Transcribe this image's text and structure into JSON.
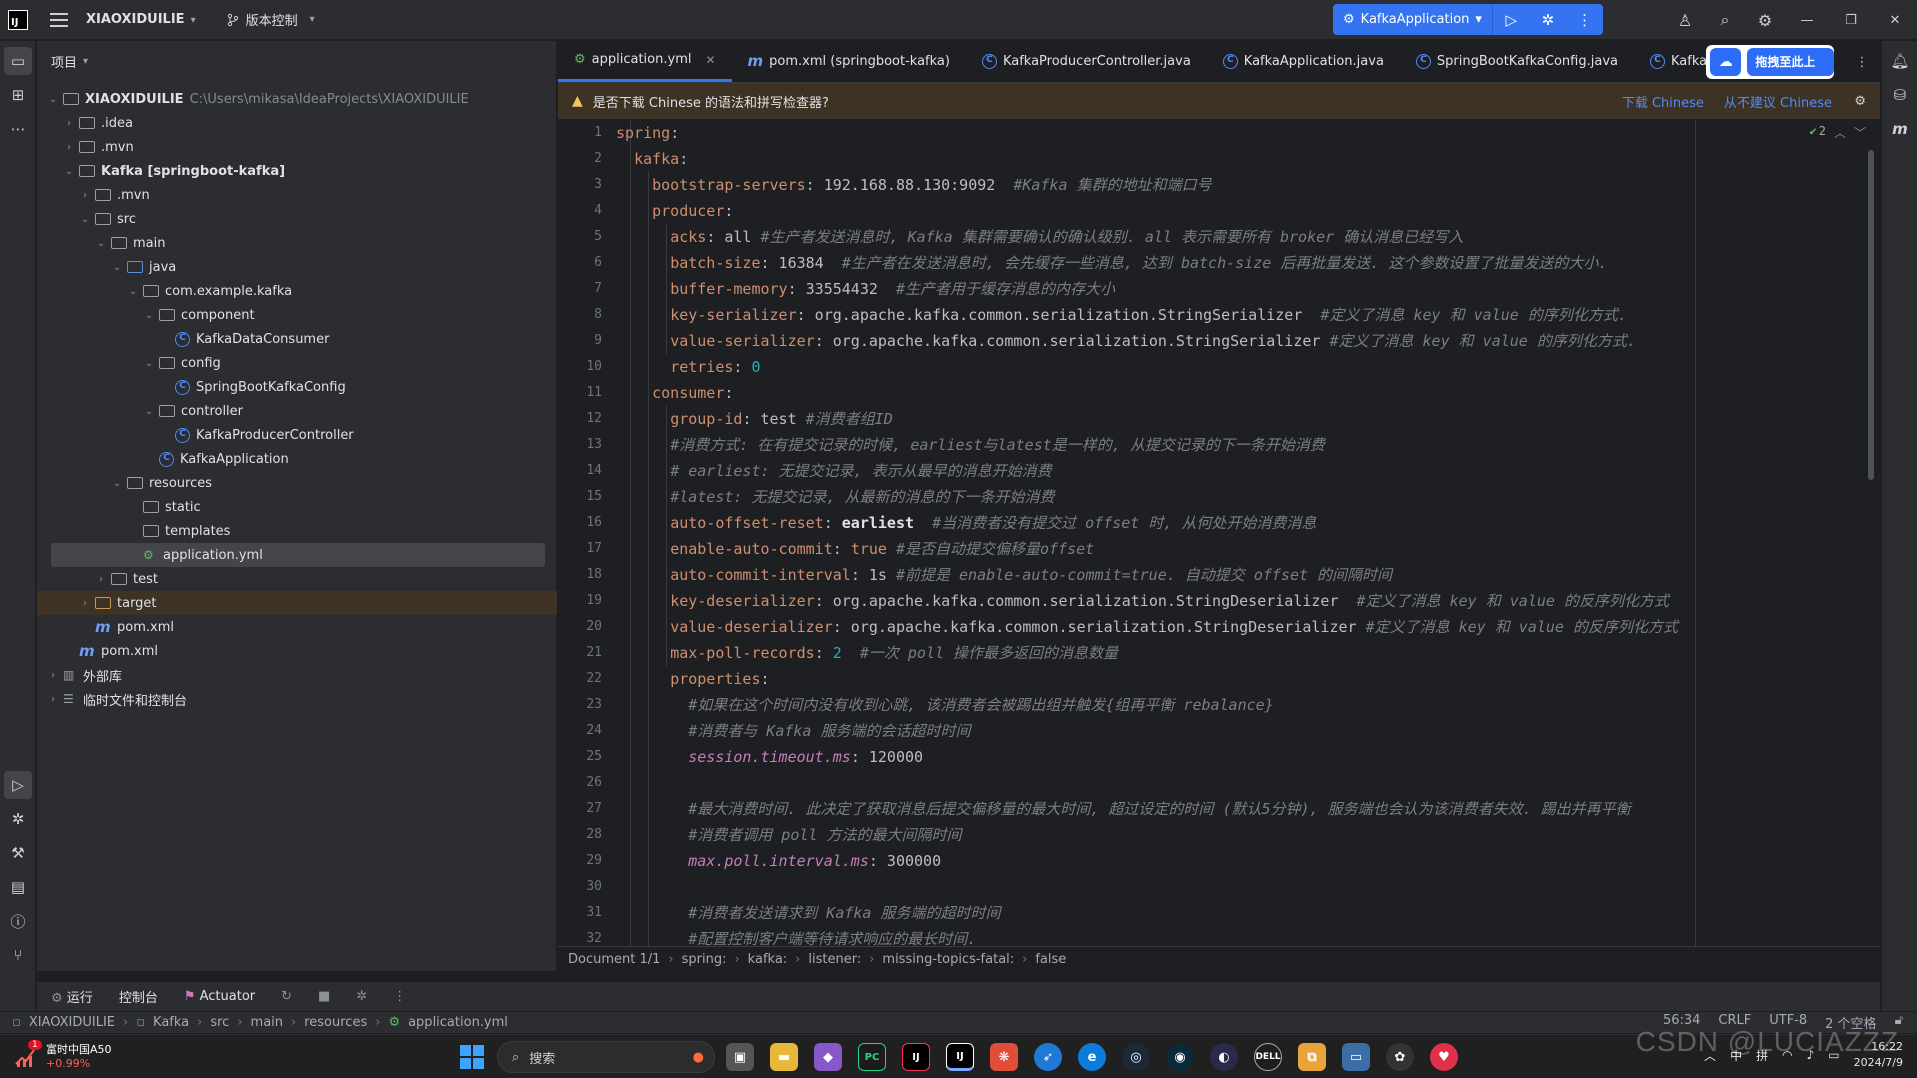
{
  "titlebar": {
    "project": "XIAOXIDUILIE",
    "vcs": "版本控制",
    "run_config": "KafkaApplication"
  },
  "project_panel": {
    "header": "项目",
    "tree": [
      {
        "depth": 0,
        "chev": "v",
        "icon": "project",
        "label": "XIAOXIDUILIE",
        "hint": "C:\\Users\\mikasa\\IdeaProjects\\XIAOXIDUILIE",
        "bold": true
      },
      {
        "depth": 1,
        "chev": ">",
        "icon": "folder",
        "label": ".idea"
      },
      {
        "depth": 1,
        "chev": ">",
        "icon": "folder",
        "label": ".mvn"
      },
      {
        "depth": 1,
        "chev": "v",
        "icon": "folder",
        "label": "Kafka [springboot-kafka]",
        "bold": true
      },
      {
        "depth": 2,
        "chev": ">",
        "icon": "folder",
        "label": ".mvn"
      },
      {
        "depth": 2,
        "chev": "v",
        "icon": "folder",
        "label": "src"
      },
      {
        "depth": 3,
        "chev": "v",
        "icon": "folder",
        "label": "main"
      },
      {
        "depth": 4,
        "chev": "v",
        "icon": "folder-blue",
        "label": "java"
      },
      {
        "depth": 5,
        "chev": "v",
        "icon": "package",
        "label": "com.example.kafka"
      },
      {
        "depth": 6,
        "chev": "v",
        "icon": "package",
        "label": "component"
      },
      {
        "depth": 7,
        "chev": "",
        "icon": "class",
        "label": "KafkaDataConsumer"
      },
      {
        "depth": 6,
        "chev": "v",
        "icon": "package",
        "label": "config"
      },
      {
        "depth": 7,
        "chev": "",
        "icon": "class",
        "label": "SpringBootKafkaConfig"
      },
      {
        "depth": 6,
        "chev": "v",
        "icon": "package",
        "label": "controller"
      },
      {
        "depth": 7,
        "chev": "",
        "icon": "class",
        "label": "KafkaProducerController"
      },
      {
        "depth": 6,
        "chev": "",
        "icon": "class",
        "label": "KafkaApplication"
      },
      {
        "depth": 4,
        "chev": "v",
        "icon": "folder",
        "label": "resources"
      },
      {
        "depth": 5,
        "chev": "",
        "icon": "folder",
        "label": "static"
      },
      {
        "depth": 5,
        "chev": "",
        "icon": "folder",
        "label": "templates"
      },
      {
        "depth": 5,
        "chev": "",
        "icon": "yml",
        "label": "application.yml",
        "selected": true
      },
      {
        "depth": 3,
        "chev": ">",
        "icon": "folder",
        "label": "test"
      },
      {
        "depth": 2,
        "chev": ">",
        "icon": "folder-excluded",
        "label": "target",
        "target": true
      },
      {
        "depth": 2,
        "chev": "",
        "icon": "maven",
        "label": "pom.xml"
      },
      {
        "depth": 1,
        "chev": "",
        "icon": "maven",
        "label": "pom.xml"
      },
      {
        "depth": 0,
        "chev": ">",
        "icon": "library",
        "label": "外部库"
      },
      {
        "depth": 0,
        "chev": ">",
        "icon": "scratch",
        "label": "临时文件和控制台"
      }
    ]
  },
  "tabs": [
    {
      "label": "application.yml",
      "icon": "yml",
      "active": true
    },
    {
      "label": "pom.xml (springboot-kafka)",
      "icon": "maven"
    },
    {
      "label": "KafkaProducerController.java",
      "icon": "class"
    },
    {
      "label": "KafkaApplication.java",
      "icon": "class"
    },
    {
      "label": "SpringBootKafkaConfig.java",
      "icon": "class"
    },
    {
      "label": "KafkaDat",
      "icon": "class"
    }
  ],
  "upload_button": "拖拽至此上传",
  "banner": {
    "text": "是否下载 Chinese 的语法和拼写检查器?",
    "download": "下载 Chinese",
    "never": "从不建议 Chinese"
  },
  "inspection_count": "2",
  "code_lines": [
    [
      [
        "k",
        "spring"
      ],
      [
        "v",
        ":"
      ]
    ],
    [
      [
        "v",
        "  "
      ],
      [
        "k",
        "kafka"
      ],
      [
        "v",
        ":"
      ]
    ],
    [
      [
        "v",
        "    "
      ],
      [
        "k",
        "bootstrap-servers"
      ],
      [
        "v",
        ": 192.168.88.130:9092  "
      ],
      [
        "c",
        "#Kafka 集群的地址和端口号"
      ]
    ],
    [
      [
        "v",
        "    "
      ],
      [
        "k",
        "producer"
      ],
      [
        "v",
        ":"
      ]
    ],
    [
      [
        "v",
        "      "
      ],
      [
        "k",
        "acks"
      ],
      [
        "v",
        ": all "
      ],
      [
        "c",
        "#生产者发送消息时, Kafka 集群需要确认的确认级别. all 表示需要所有 broker 确认消息已经写入"
      ]
    ],
    [
      [
        "v",
        "      "
      ],
      [
        "k",
        "batch-size"
      ],
      [
        "v",
        ": 16384  "
      ],
      [
        "c",
        "#生产者在发送消息时, 会先缓存一些消息, 达到 batch-size 后再批量发送. 这个参数设置了批量发送的大小."
      ]
    ],
    [
      [
        "v",
        "      "
      ],
      [
        "k",
        "buffer-memory"
      ],
      [
        "v",
        ": 33554432  "
      ],
      [
        "c",
        "#生产者用于缓存消息的内存大小"
      ]
    ],
    [
      [
        "v",
        "      "
      ],
      [
        "k",
        "key-serializer"
      ],
      [
        "v",
        ": org.apache.kafka.common.serialization.StringSerializer  "
      ],
      [
        "c",
        "#定义了消息 key 和 value 的序列化方式."
      ]
    ],
    [
      [
        "v",
        "      "
      ],
      [
        "k",
        "value-serializer"
      ],
      [
        "v",
        ": org.apache.kafka.common.serialization.StringSerializer "
      ],
      [
        "c",
        "#定义了消息 key 和 value 的序列化方式."
      ]
    ],
    [
      [
        "v",
        "      "
      ],
      [
        "k",
        "retries"
      ],
      [
        "v",
        ": "
      ],
      [
        "n",
        "0"
      ]
    ],
    [
      [
        "v",
        "    "
      ],
      [
        "k",
        "consumer"
      ],
      [
        "v",
        ":"
      ]
    ],
    [
      [
        "v",
        "      "
      ],
      [
        "k",
        "group-id"
      ],
      [
        "v",
        ": test "
      ],
      [
        "c",
        "#消费者组ID"
      ]
    ],
    [
      [
        "v",
        "      "
      ],
      [
        "c",
        "#消费方式: 在有提交记录的时候, earliest与latest是一样的, 从提交记录的下一条开始消费"
      ]
    ],
    [
      [
        "v",
        "      "
      ],
      [
        "c",
        "# earliest: 无提交记录, 表示从最早的消息开始消费"
      ]
    ],
    [
      [
        "v",
        "      "
      ],
      [
        "c",
        "#latest: 无提交记录, 从最新的消息的下一条开始消费"
      ]
    ],
    [
      [
        "v",
        "      "
      ],
      [
        "k",
        "auto-offset-reset"
      ],
      [
        "v",
        ": "
      ],
      [
        "b",
        "earliest"
      ],
      [
        "v",
        "  "
      ],
      [
        "c",
        "#当消费者没有提交过 offset 时, 从何处开始消费消息"
      ]
    ],
    [
      [
        "v",
        "      "
      ],
      [
        "k",
        "enable-auto-commit"
      ],
      [
        "v",
        ": "
      ],
      [
        "k",
        "true"
      ],
      [
        "v",
        " "
      ],
      [
        "c",
        "#是否自动提交偏移量offset"
      ]
    ],
    [
      [
        "v",
        "      "
      ],
      [
        "k",
        "auto-commit-interval"
      ],
      [
        "v",
        ": 1s "
      ],
      [
        "c",
        "#前提是 enable-auto-commit=true. 自动提交 offset 的间隔时间"
      ]
    ],
    [
      [
        "v",
        "      "
      ],
      [
        "k",
        "key-deserializer"
      ],
      [
        "v",
        ": org.apache.kafka.common.serialization.StringDeserializer  "
      ],
      [
        "c",
        "#定义了消息 key 和 value 的反序列化方式"
      ]
    ],
    [
      [
        "v",
        "      "
      ],
      [
        "k",
        "value-deserializer"
      ],
      [
        "v",
        ": org.apache.kafka.common.serialization.StringDeserializer "
      ],
      [
        "c",
        "#定义了消息 key 和 value 的反序列化方式"
      ]
    ],
    [
      [
        "v",
        "      "
      ],
      [
        "k",
        "max-poll-records"
      ],
      [
        "v",
        ": "
      ],
      [
        "n",
        "2"
      ],
      [
        "v",
        "  "
      ],
      [
        "c",
        "#一次 poll 操作最多返回的消息数量"
      ]
    ],
    [
      [
        "v",
        "      "
      ],
      [
        "k",
        "properties"
      ],
      [
        "v",
        ":"
      ]
    ],
    [
      [
        "v",
        "        "
      ],
      [
        "c",
        "#如果在这个时间内没有收到心跳, 该消费者会被踢出组并触发{组再平衡 rebalance}"
      ]
    ],
    [
      [
        "v",
        "        "
      ],
      [
        "c",
        "#消费者与 Kafka 服务端的会话超时时间"
      ]
    ],
    [
      [
        "v",
        "        "
      ],
      [
        "kv",
        "session.timeout.ms"
      ],
      [
        "v",
        ": 120000"
      ]
    ],
    [],
    [
      [
        "v",
        "        "
      ],
      [
        "c",
        "#最大消费时间. 此决定了获取消息后提交偏移量的最大时间, 超过设定的时间 (默认5分钟), 服务端也会认为该消费者失效. 踢出并再平衡"
      ]
    ],
    [
      [
        "v",
        "        "
      ],
      [
        "c",
        "#消费者调用 poll 方法的最大间隔时间"
      ]
    ],
    [
      [
        "v",
        "        "
      ],
      [
        "kv",
        "max.poll.interval.ms"
      ],
      [
        "v",
        ": 300000"
      ]
    ],
    [],
    [
      [
        "v",
        "        "
      ],
      [
        "c",
        "#消费者发送请求到 Kafka 服务端的超时时间"
      ]
    ],
    [
      [
        "v",
        "        "
      ],
      [
        "c",
        "#配置控制客户端等待请求响应的最长时间."
      ]
    ]
  ],
  "breadcrumb": [
    "Document 1/1",
    "spring:",
    "kafka:",
    "listener:",
    "missing-topics-fatal:",
    "false"
  ],
  "run_bar": [
    "运行",
    "控制台",
    "Actuator"
  ],
  "status": {
    "crumbs": [
      "XIAOXIDUILIE",
      "Kafka",
      "src",
      "main",
      "resources",
      "application.yml"
    ],
    "position": "56:34",
    "line_sep": "CRLF",
    "encoding": "UTF-8",
    "indent": "2 个空格"
  },
  "taskbar": {
    "stock_name": "富时中国A50",
    "stock_change": "+0.99%",
    "stock_badge": "1",
    "search": "搜索",
    "ime1": "中",
    "ime2": "拼",
    "time": "16:22",
    "date": "2024/7/9",
    "watermark": "CSDN @LUCIAZZZ"
  }
}
